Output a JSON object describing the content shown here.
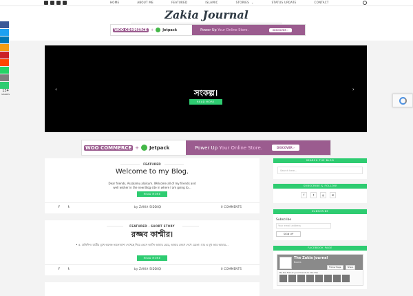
{
  "topbar": {
    "social_icons": [
      "facebook-icon",
      "twitter-icon",
      "instagram-icon",
      "rss-icon"
    ],
    "nav": [
      "HOME",
      "ABOUT ME",
      "FEATURED",
      "ISLAMIC",
      "STORIES",
      "STATUS UPDATE",
      "CONTACT"
    ],
    "stories_caret": "⌄"
  },
  "header": {
    "logo": "Zakia Journal"
  },
  "ad": {
    "woo": "WOO COMMERCE",
    "plus": "+",
    "jetpack": "Jetpack",
    "power": "Power Up",
    "highlight": "Your Online Store.",
    "button": "DISCOVER ›"
  },
  "share_bar": {
    "buttons": [
      {
        "icon": "facebook-icon",
        "color": "#3b5998"
      },
      {
        "icon": "twitter-icon",
        "color": "#1da1f2"
      },
      {
        "icon": "linkedin-icon",
        "color": "#0077b5"
      },
      {
        "icon": "email-icon",
        "color": "#f39c12"
      },
      {
        "icon": "pinterest-icon",
        "color": "#cb2027"
      },
      {
        "icon": "reddit-icon",
        "color": "#ff4500"
      },
      {
        "icon": "whatsapp-icon",
        "color": "#25d366"
      },
      {
        "icon": "mail-icon",
        "color": "#7f7f7f"
      },
      {
        "icon": "more-icon",
        "color": "#2ecc71"
      }
    ],
    "count": "134",
    "count_label": "SHARES"
  },
  "slider": {
    "title": "সংকল্প।",
    "button": "READ MORE",
    "prev": "‹",
    "next": "›"
  },
  "posts": [
    {
      "category": "FEATURED",
      "title": "Welcome to my Blog.",
      "excerpt": "Dear friends, Assalamu alaikum. Welcome all of my friends and well wisher in the new Blog site in where I am going to...",
      "button": "READ MORE",
      "author": "by ZAKIA SIDDIQI",
      "comments": "0 COMMENTS"
    },
    {
      "category": "FEATURED · SHORT STORY",
      "title": "রজ্জব কাশ্মীর।",
      "excerpt": "• ৫. প্রতিদিন। যাত্রীর মুখে অনেক ভালোবাসা দেখেছে নিয়ে ভেসে আসি। আমার মেয়ে, আমার জেগে দেখে যেতো। যার এ মুখ আর আমার...",
      "button": "READ MORE",
      "author": "by ZAKIA SIDDIQI",
      "comments": "0 COMMENTS"
    }
  ],
  "widgets": {
    "search": {
      "heading": "SEARCH THE BLOG",
      "placeholder": "Search here..."
    },
    "follow": {
      "heading": "SUBSCRIBE & FOLLOW",
      "icons": [
        "f",
        "t",
        "◎",
        "✉"
      ]
    },
    "subscribe": {
      "heading": "SUBSCRIBE",
      "label": "Subscribe",
      "placeholder": "Your email address",
      "button": "SIGN UP"
    },
    "facebook": {
      "heading": "FACEBOOK PAGE",
      "page_name": "The Zakia Journal",
      "likes": "Books",
      "follow_btn": "Follow Page",
      "share_btn": "Share",
      "friends_text": "Be the first of your friends to like this"
    }
  }
}
